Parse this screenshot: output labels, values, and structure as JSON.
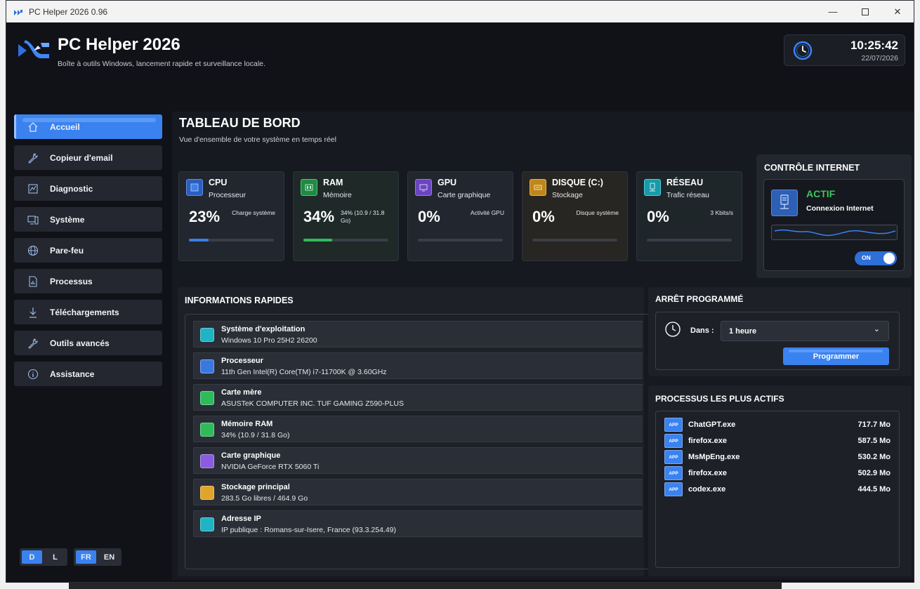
{
  "window": {
    "title": "PC Helper 2026 0.96"
  },
  "header": {
    "app_name": "PC Helper 2026",
    "subtitle": "Boîte à outils Windows, lancement rapide et surveillance locale.",
    "time": "10:25:42",
    "date": "22/07/2026"
  },
  "sidebar": {
    "items": [
      {
        "label": "Accueil",
        "icon": "home-icon",
        "active": true
      },
      {
        "label": "Copieur d'email",
        "icon": "wrench-icon"
      },
      {
        "label": "Diagnostic",
        "icon": "chart-icon"
      },
      {
        "label": "Système",
        "icon": "computer-icon"
      },
      {
        "label": "Pare-feu",
        "icon": "globe-icon"
      },
      {
        "label": "Processus",
        "icon": "document-chart-icon"
      },
      {
        "label": "Téléchargements",
        "icon": "download-icon"
      },
      {
        "label": "Outils avancés",
        "icon": "wrench-icon"
      },
      {
        "label": "Assistance",
        "icon": "info-icon"
      }
    ],
    "theme": {
      "dark": "D",
      "light": "L",
      "selected": "D"
    },
    "lang": {
      "fr": "FR",
      "en": "EN",
      "selected": "FR"
    }
  },
  "dashboard": {
    "title": "TABLEAU DE BORD",
    "subtitle": "Vue d'ensemble de votre système en temps réel"
  },
  "stats": [
    {
      "name": "CPU",
      "desc": "Processeur",
      "value": "23%",
      "note": "Charge système",
      "percent": 23,
      "color": "#3a7ee8"
    },
    {
      "name": "RAM",
      "desc": "Mémoire",
      "value": "34%",
      "note": "34% (10.9 / 31.8 Go)",
      "percent": 34,
      "color": "#2ebc5a"
    },
    {
      "name": "GPU",
      "desc": "Carte graphique",
      "value": "0%",
      "note": "Activité GPU",
      "percent": 0,
      "color": "#8a5ce0"
    },
    {
      "name": "DISQUE (C:)",
      "desc": "Stockage",
      "value": "0%",
      "note": "Disque système",
      "percent": 0,
      "color": "#e0a42a"
    },
    {
      "name": "RÉSEAU",
      "desc": "Trafic réseau",
      "value": "0%",
      "note": "3 Kbits/s",
      "percent": 0,
      "color": "#22b8c8"
    }
  ],
  "internet": {
    "title": "CONTRÔLE INTERNET",
    "state": "ACTIF",
    "label": "Connexion Internet",
    "switch": "ON"
  },
  "info": {
    "title": "INFORMATIONS RAPIDES",
    "rows": [
      {
        "name": "Système d'exploitation",
        "value": "Windows 10 Pro 25H2 26200",
        "color": "#1fb3c4"
      },
      {
        "name": "Processeur",
        "value": "11th Gen Intel(R) Core(TM) i7-11700K @ 3.60GHz",
        "color": "#3a78e0"
      },
      {
        "name": "Carte mère",
        "value": "ASUSTeK COMPUTER INC. TUF GAMING Z590-PLUS",
        "color": "#2ebc5a"
      },
      {
        "name": "Mémoire RAM",
        "value": "34%  (10.9 / 31.8 Go)",
        "color": "#2ebc5a"
      },
      {
        "name": "Carte graphique",
        "value": "NVIDIA GeForce RTX 5060 Ti",
        "color": "#8a5ce0"
      },
      {
        "name": "Stockage principal",
        "value": "283.5 Go libres / 464.9 Go",
        "color": "#e0a42a"
      },
      {
        "name": "Adresse IP",
        "value": "IP publique : Romans-sur-Isere, France (93.3.254.49)",
        "color": "#1fb3c4"
      }
    ]
  },
  "shutdown": {
    "title": "ARRÊT PROGRAMMÉ",
    "label": "Dans :",
    "selected": "1 heure",
    "button": "Programmer"
  },
  "processes": {
    "title": "PROCESSUS LES PLUS ACTIFS",
    "badge": "APP",
    "rows": [
      {
        "name": "ChatGPT.exe",
        "mem": "717.7 Mo"
      },
      {
        "name": "firefox.exe",
        "mem": "587.5 Mo"
      },
      {
        "name": "MsMpEng.exe",
        "mem": "530.2 Mo"
      },
      {
        "name": "firefox.exe",
        "mem": "502.9 Mo"
      },
      {
        "name": "codex.exe",
        "mem": "444.5 Mo"
      }
    ]
  }
}
